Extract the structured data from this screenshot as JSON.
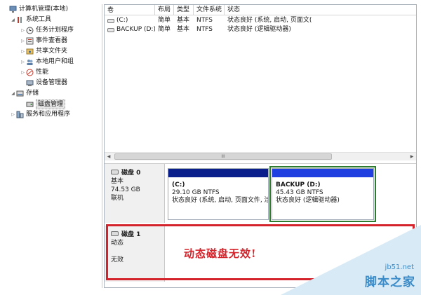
{
  "tree": {
    "root": "计算机管理(本地)",
    "items": [
      {
        "label": "系统工具",
        "indent": 1,
        "twisty": "expanded",
        "icon": "tools-icon"
      },
      {
        "label": "任务计划程序",
        "indent": 2,
        "twisty": "collapsed",
        "icon": "clock-icon"
      },
      {
        "label": "事件查看器",
        "indent": 2,
        "twisty": "collapsed",
        "icon": "event-viewer-icon"
      },
      {
        "label": "共享文件夹",
        "indent": 2,
        "twisty": "collapsed",
        "icon": "shared-folder-icon"
      },
      {
        "label": "本地用户和组",
        "indent": 2,
        "twisty": "collapsed",
        "icon": "users-icon"
      },
      {
        "label": "性能",
        "indent": 2,
        "twisty": "collapsed",
        "icon": "performance-icon"
      },
      {
        "label": "设备管理器",
        "indent": 2,
        "twisty": "none",
        "icon": "device-manager-icon"
      },
      {
        "label": "存储",
        "indent": 1,
        "twisty": "expanded",
        "icon": "storage-icon"
      },
      {
        "label": "磁盘管理",
        "indent": 2,
        "twisty": "none",
        "icon": "disk-management-icon",
        "selected": true
      },
      {
        "label": "服务和应用程序",
        "indent": 1,
        "twisty": "collapsed",
        "icon": "services-icon"
      }
    ]
  },
  "volumes": {
    "headers": [
      "卷",
      "布局",
      "类型",
      "文件系统",
      "状态"
    ],
    "rows": [
      {
        "volume": "(C:)",
        "layout": "简单",
        "type": "基本",
        "fs": "NTFS",
        "status": "状态良好 (系统, 启动, 页面文("
      },
      {
        "volume": "BACKUP (D:)",
        "layout": "简单",
        "type": "基本",
        "fs": "NTFS",
        "status": "状态良好 (逻辑驱动器)"
      }
    ],
    "scroll_grip": "III"
  },
  "disks": {
    "disk0": {
      "name": "磁盘 0",
      "kind": "基本",
      "size": "74.53 GB",
      "state": "联机",
      "partitions": [
        {
          "name": "(C:)",
          "size": "29.10 GB NTFS",
          "status": "状态良好 (系统, 启动, 页面文件, 活"
        },
        {
          "name": "BACKUP  (D:)",
          "size": "45.43 GB NTFS",
          "status": "状态良好 (逻辑驱动器)"
        }
      ]
    },
    "disk1": {
      "name": "磁盘 1",
      "kind": "动态",
      "state": "无效",
      "message": "动态磁盘无效!"
    }
  },
  "watermark": {
    "url": "jb51.net",
    "name": "脚本之家"
  },
  "colors": {
    "primary_partition": "#0a1f8c",
    "logical_partition": "#1f3fe0",
    "highlight_red": "#d4232a",
    "selection_green": "#2e7a2e",
    "watermark_blue": "#3a8bc7"
  }
}
